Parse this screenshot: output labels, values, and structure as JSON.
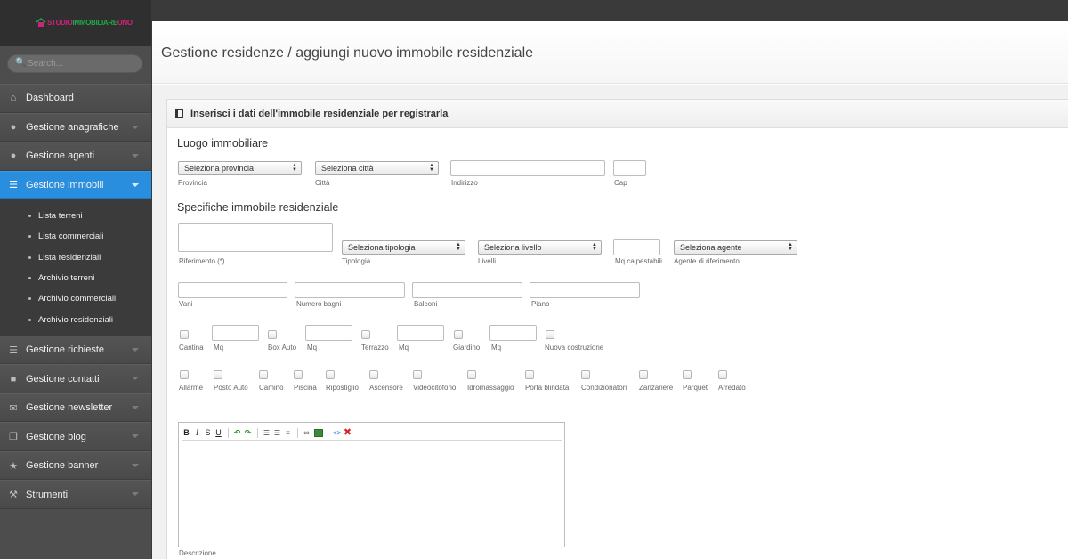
{
  "logo": {
    "text_left": "STUDIO",
    "text_mid": "IMMOBILIARE",
    "text_right": "UNO"
  },
  "search": {
    "placeholder": "Search..."
  },
  "nav": {
    "dashboard": "Dashboard",
    "anagrafiche": "Gestione anagrafiche",
    "agenti": "Gestione agenti",
    "immobili": "Gestione immobili",
    "richieste": "Gestione richieste",
    "contatti": "Gestione contatti",
    "newsletter": "Gestione newsletter",
    "blog": "Gestione blog",
    "banner": "Gestione banner",
    "strumenti": "Strumenti"
  },
  "subnav": [
    "Lista terreni",
    "Lista commerciali",
    "Lista residenziali",
    "Archivio terreni",
    "Archivio commerciali",
    "Archivio residenziali"
  ],
  "page": {
    "title": "Gestione residenze / aggiungi nuovo immobile residenziale",
    "panel_title": "Inserisci i dati dell'immobile residenziale per registrarla"
  },
  "luogo": {
    "heading": "Luogo immobiliare",
    "provincia_select": "Seleziona provincia",
    "provincia_label": "Provincia",
    "citta_select": "Seleziona città",
    "citta_label": "Città",
    "indirizzo_label": "Indirizzo",
    "cap_label": "Cap"
  },
  "specifiche": {
    "heading": "Specifiche immobile residenziale",
    "riferimento_label": "Riferimento (*)",
    "tipologia_select": "Seleziona tipologia",
    "tipologia_label": "Tipologia",
    "livello_select": "Seleziona livello",
    "livelli_label": "Livelli",
    "mq_label": "Mq calpestabili",
    "agente_select": "Seleziona agente",
    "agente_label": "Agente di riferimento",
    "vani_label": "Vani",
    "bagni_label": "Numero bagni",
    "balconi_label": "Balconi",
    "piano_label": "Piano"
  },
  "optional_row1": {
    "cantina": "Cantina",
    "mq1": "Mq",
    "box": "Box Auto",
    "mq2": "Mq",
    "terrazzo": "Terrazzo",
    "mq3": "Mq",
    "giardino": "Giardino",
    "mq4": "Mq",
    "nuova": "Nuova costruzione"
  },
  "optional_row2": [
    "Allarme",
    "Posto Auto",
    "Camino",
    "Piscina",
    "Ripostiglio",
    "Ascensore",
    "Videocitofono",
    "Idromassaggio",
    "Porta blindata",
    "Condizionatori",
    "Zanzariere",
    "Parquet",
    "Arredato"
  ],
  "editor": {
    "toolbar": {
      "bold": "B",
      "italic": "I",
      "strike": "S",
      "underline": "U"
    },
    "descrizione_label": "Descrizione"
  },
  "colors": {
    "accent": "#2a8ede",
    "sidebar": "#4d4d4d",
    "logo_pink": "#d1227a",
    "logo_green": "#1ea84a"
  }
}
